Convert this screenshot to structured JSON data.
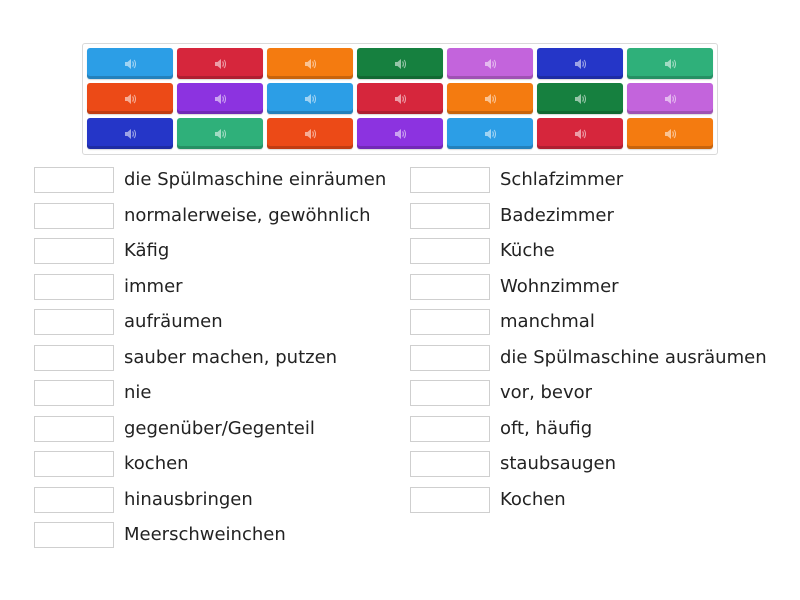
{
  "tiles": {
    "rows": [
      [
        {
          "color": "#2c9ee6"
        },
        {
          "color": "#d6263c"
        },
        {
          "color": "#f47b10"
        },
        {
          "color": "#16803f"
        },
        {
          "color": "#c364dc"
        },
        {
          "color": "#2536c8"
        },
        {
          "color": "#2fb07a"
        }
      ],
      [
        {
          "color": "#ec4a17"
        },
        {
          "color": "#8c33e0"
        },
        {
          "color": "#2c9ee6"
        },
        {
          "color": "#d6263c"
        },
        {
          "color": "#f47b10"
        },
        {
          "color": "#16803f"
        },
        {
          "color": "#c364dc"
        }
      ],
      [
        {
          "color": "#2536c8"
        },
        {
          "color": "#2fb07a"
        },
        {
          "color": "#ec4a17"
        },
        {
          "color": "#8c33e0"
        },
        {
          "color": "#2c9ee6"
        },
        {
          "color": "#d6263c"
        },
        {
          "color": "#f47b10"
        }
      ]
    ],
    "icon": "speaker-icon"
  },
  "left_words": [
    "die Spülmaschine einräumen",
    "normalerweise, gewöhnlich",
    "Käfig",
    "immer",
    "aufräumen",
    "sauber machen, putzen",
    "nie",
    "gegenüber/Gegenteil",
    "kochen",
    "hinausbringen",
    "Meerschweinchen"
  ],
  "right_words": [
    "Schlafzimmer",
    "Badezimmer",
    "Küche",
    "Wohnzimmer",
    "manchmal",
    "die Spülmaschine ausräumen",
    "vor, bevor",
    "oft, häufig",
    "staubsaugen",
    "Kochen"
  ]
}
